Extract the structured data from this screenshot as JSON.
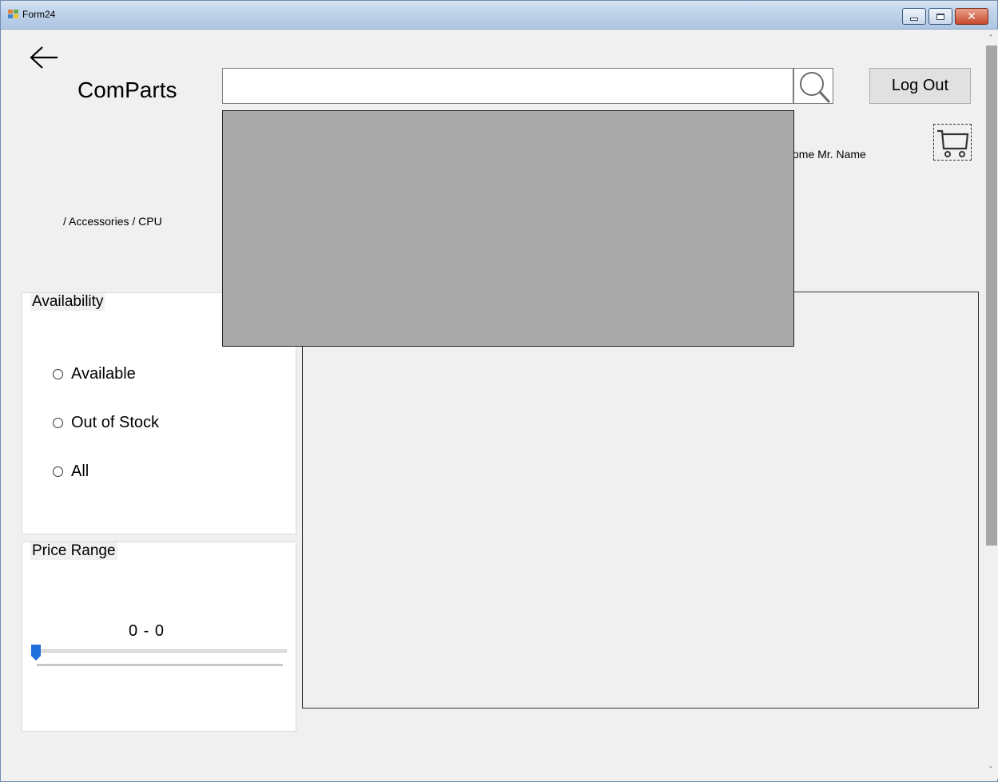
{
  "window": {
    "title": "Form24",
    "controls": [
      "minimize",
      "maximize",
      "close"
    ],
    "close_glyph": "✕"
  },
  "header": {
    "back_icon": "arrow-left-icon",
    "brand": "ComParts",
    "search": {
      "value": "",
      "placeholder": ""
    },
    "search_icon": "magnifier-icon",
    "logout_label": "Log Out",
    "welcome_text": "ome Mr. Name",
    "cart_icon": "shopping-cart-icon"
  },
  "breadcrumb": "/ Accessories / CPU",
  "filters": {
    "availability": {
      "title": "Availability",
      "options": [
        {
          "label": "Available",
          "selected": false
        },
        {
          "label": "Out of Stock",
          "selected": false
        },
        {
          "label": "All",
          "selected": false
        }
      ]
    },
    "price_range": {
      "title": "Price Range",
      "value_text": "0  -  0",
      "slider_value": 0
    }
  },
  "scrollbar": {
    "up_glyph": "˄",
    "down_glyph": "˅"
  },
  "colors": {
    "slider_thumb": "#1e6fd9",
    "dropdown_overlay": "#a9a9a9",
    "window_bg": "#f0f0f0"
  }
}
